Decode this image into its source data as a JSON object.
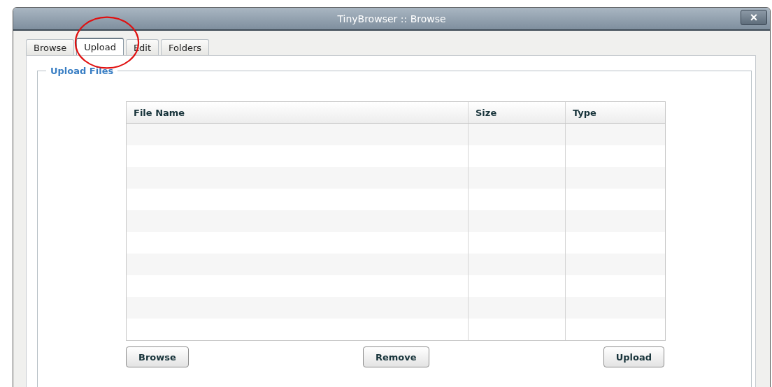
{
  "window": {
    "title": "TinyBrowser :: Browse",
    "close": "×"
  },
  "tabs": [
    {
      "label": "Browse",
      "selected": false
    },
    {
      "label": "Upload",
      "selected": true
    },
    {
      "label": "Edit",
      "selected": false
    },
    {
      "label": "Folders",
      "selected": false
    }
  ],
  "fieldset": {
    "legend": "Upload Files"
  },
  "table": {
    "columns": [
      "File Name",
      "Size",
      "Type"
    ]
  },
  "buttons": [
    "Browse",
    "Remove",
    "Upload"
  ]
}
